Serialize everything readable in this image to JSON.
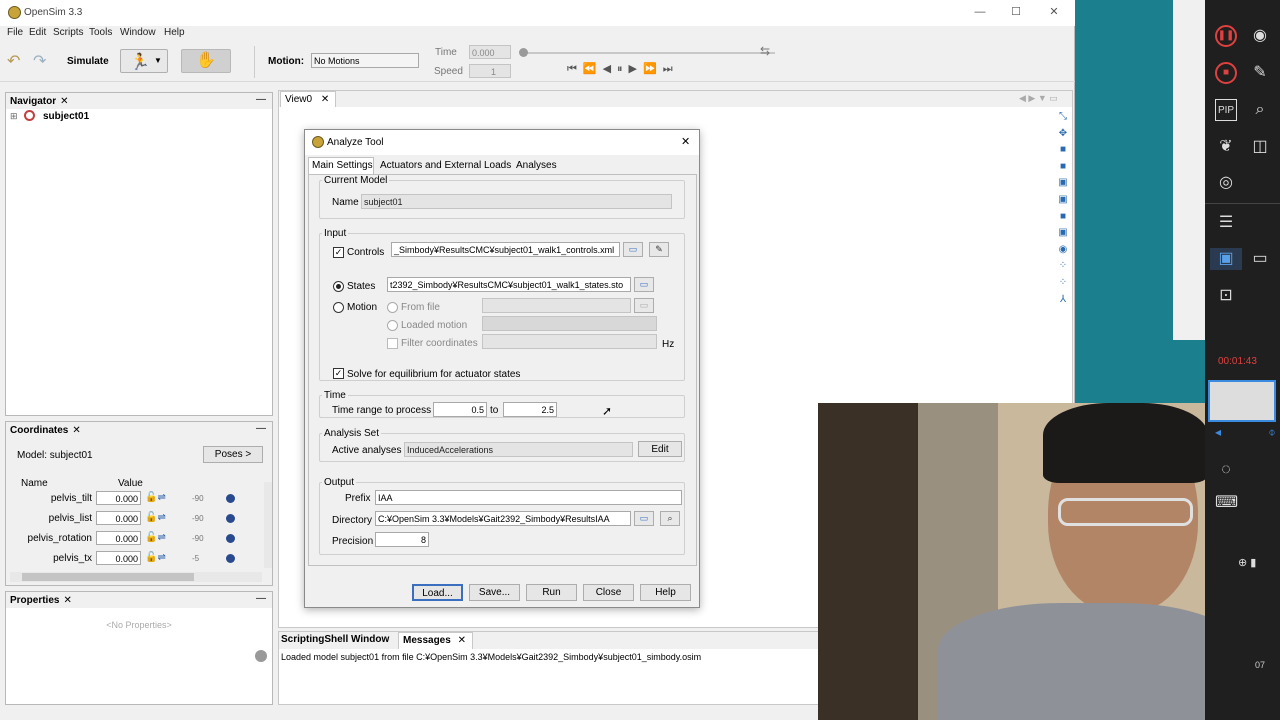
{
  "app": {
    "title": "OpenSim 3.3"
  },
  "menu": [
    "File",
    "Edit",
    "Scripts",
    "Tools",
    "Window",
    "Help"
  ],
  "toolbar": {
    "simulate_label": "Simulate",
    "motion_label": "Motion:",
    "motion_value": "No Motions",
    "time_label": "Time",
    "time_value": "0.000",
    "speed_label": "Speed",
    "speed_value": "1"
  },
  "navigator": {
    "title": "Navigator",
    "model": "subject01"
  },
  "coordinates": {
    "title": "Coordinates",
    "model_label": "Model:",
    "model_value": "subject01",
    "poses_label": "Poses >",
    "col_name": "Name",
    "col_value": "Value",
    "rows": [
      {
        "name": "pelvis_tilt",
        "value": "0.000",
        "min": "-90"
      },
      {
        "name": "pelvis_list",
        "value": "0.000",
        "min": "-90"
      },
      {
        "name": "pelvis_rotation",
        "value": "0.000",
        "min": "-90"
      },
      {
        "name": "pelvis_tx",
        "value": "0.000",
        "min": "-5"
      }
    ]
  },
  "properties": {
    "title": "Properties",
    "empty": "<No Properties>"
  },
  "view": {
    "tab": "View0"
  },
  "bottom": {
    "tab1": "ScriptingShell Window",
    "tab2": "Messages",
    "message": "Loaded model subject01 from file C:¥OpenSim 3.3¥Models¥Gait2392_Simbody¥subject01_simbody.osim"
  },
  "dialog": {
    "title": "Analyze Tool",
    "tabs": [
      "Main Settings",
      "Actuators and External Loads",
      "Analyses"
    ],
    "current_model": {
      "group": "Current Model",
      "name_label": "Name",
      "name_value": "subject01"
    },
    "input": {
      "group": "Input",
      "controls_label": "Controls",
      "controls_value": "_Simbody¥ResultsCMC¥subject01_walk1_controls.xml",
      "states_label": "States",
      "states_value": "t2392_Simbody¥ResultsCMC¥subject01_walk1_states.sto",
      "motion_label": "Motion",
      "from_file_label": "From file",
      "loaded_motion_label": "Loaded motion",
      "filter_label": "Filter coordinates",
      "hz_label": "Hz",
      "solve_label": "Solve for equilibrium for actuator states"
    },
    "time": {
      "group": "Time",
      "range_label": "Time range to process",
      "from": "0.5",
      "to_label": "to",
      "to": "2.5"
    },
    "analysis": {
      "group": "Analysis Set",
      "active_label": "Active analyses",
      "active_value": "InducedAccelerations",
      "edit_label": "Edit"
    },
    "output": {
      "group": "Output",
      "prefix_label": "Prefix",
      "prefix_value": "IAA",
      "directory_label": "Directory",
      "directory_value": "C:¥OpenSim 3.3¥Models¥Gait2392_Simbody¥ResultsIAA",
      "precision_label": "Precision",
      "precision_value": "8"
    },
    "buttons": [
      "Load...",
      "Save...",
      "Run",
      "Close",
      "Help"
    ]
  },
  "recorder": {
    "timer": "00:01:43",
    "side_num": "07"
  },
  "colors": {
    "teal": "#1b7f8e",
    "dark_panel": "#1f1f1f",
    "accent": "#3a6ebf"
  }
}
